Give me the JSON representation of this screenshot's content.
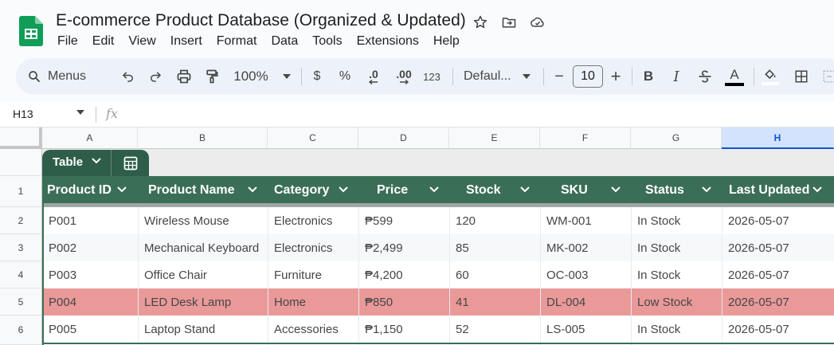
{
  "document": {
    "title": "E-commerce Product Database (Organized & Updated)"
  },
  "menu": [
    "File",
    "Edit",
    "View",
    "Insert",
    "Format",
    "Data",
    "Tools",
    "Extensions",
    "Help"
  ],
  "toolbar": {
    "search_label": "Menus",
    "zoom": "100%",
    "currency": "$",
    "percent": "%",
    "decrease_decimal": ".0",
    "increase_decimal": ".00",
    "number_format": "123",
    "font": "Defaul...",
    "minus": "−",
    "font_size": "10",
    "plus": "+",
    "bold": "B",
    "italic": "I",
    "text_color": "A"
  },
  "formula_bar": {
    "cell_ref": "H13",
    "fx": "fx"
  },
  "grid": {
    "columns": [
      "A",
      "B",
      "C",
      "D",
      "E",
      "F",
      "G",
      "H"
    ],
    "selected_column": "H",
    "row_numbers": [
      "1",
      "2",
      "3",
      "4",
      "5",
      "6"
    ]
  },
  "table": {
    "tab_label": "Table",
    "header_color": "#3b6e57",
    "highlight_color": "#ea9999",
    "headers": [
      "Product ID",
      "Product Name",
      "Category",
      "Price",
      "Stock",
      "SKU",
      "Status",
      "Last Updated"
    ],
    "rows": [
      [
        "P001",
        "Wireless Mouse",
        "Electronics",
        "₱599",
        "120",
        "WM-001",
        "In Stock",
        "2026-05-07"
      ],
      [
        "P002",
        "Mechanical Keyboard",
        "Electronics",
        "₱2,499",
        "85",
        "MK-002",
        "In Stock",
        "2026-05-07"
      ],
      [
        "P003",
        "Office Chair",
        "Furniture",
        "₱4,200",
        "60",
        "OC-003",
        "In Stock",
        "2026-05-07"
      ],
      [
        "P004",
        "LED Desk Lamp",
        "Home",
        "₱850",
        "41",
        "DL-004",
        "Low Stock",
        "2026-05-07"
      ],
      [
        "P005",
        "Laptop Stand",
        "Accessories",
        "₱1,150",
        "52",
        "LS-005",
        "In Stock",
        "2026-05-07"
      ]
    ]
  }
}
